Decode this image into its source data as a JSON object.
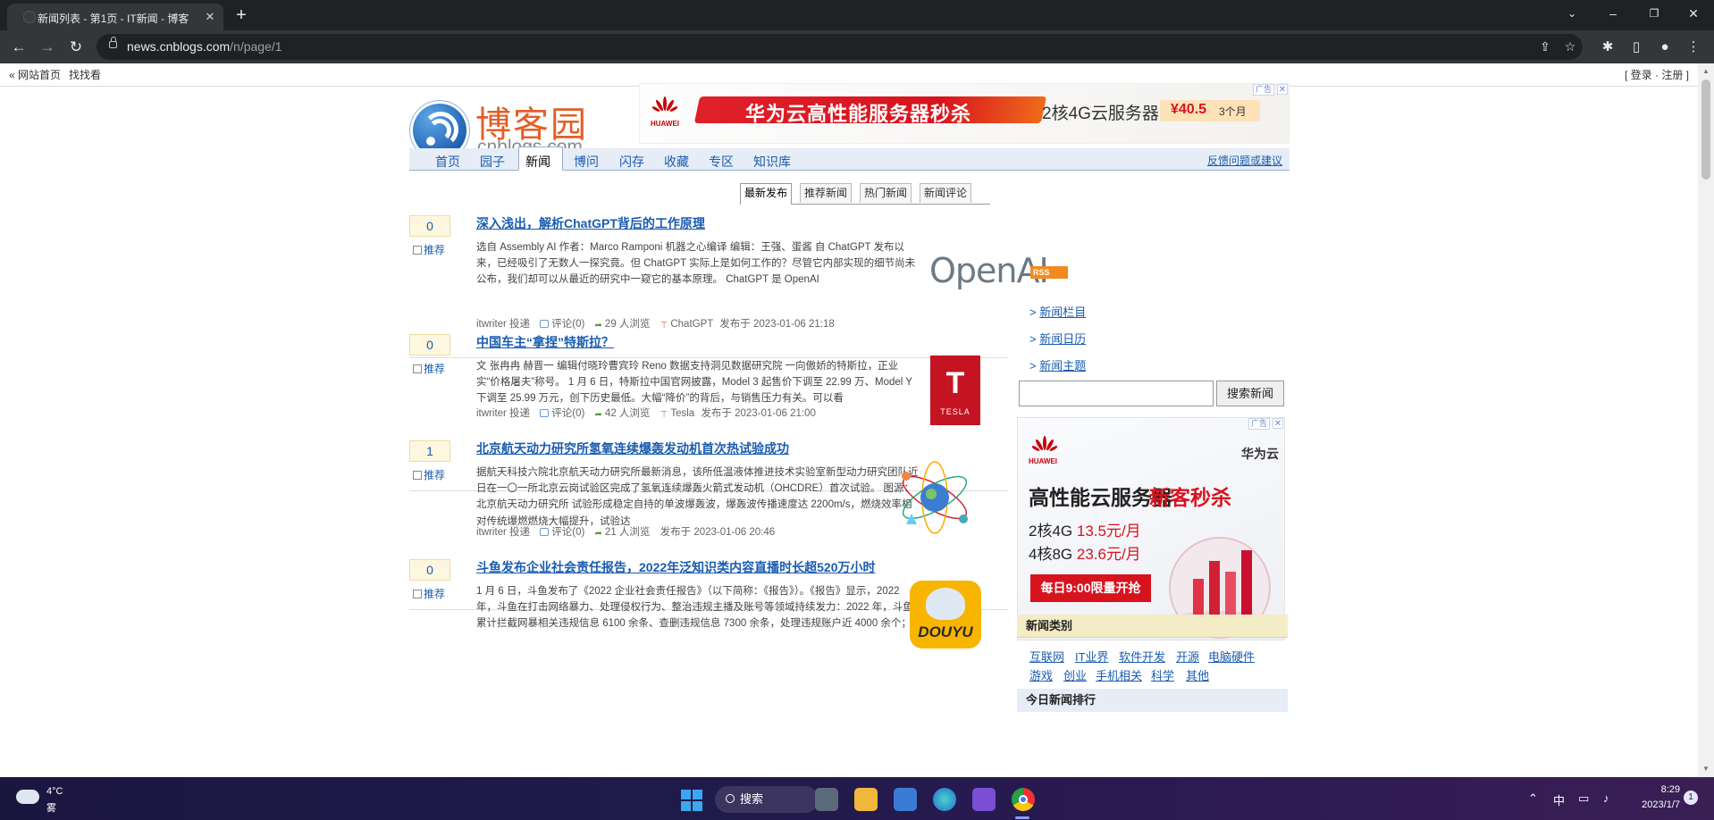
{
  "browser": {
    "tab_title": "新闻列表 - 第1页 - IT新闻 - 博客",
    "url_host": "news.cnblogs.com",
    "url_path": "/n/page/1"
  },
  "topline": {
    "home": "« 网站首页",
    "find": "找找看",
    "auth": "[ 登录 · 注册 ]"
  },
  "header": {
    "logo_cn": "博客园",
    "logo_en": "cnblogs.com"
  },
  "top_ad": {
    "brand": "HUAWEI",
    "title": "华为云高性能服务器秒杀",
    "spec": "2核4G云服务器",
    "price": "¥40.5",
    "period": "3个月",
    "tag": "广告"
  },
  "nav": {
    "items": [
      "首页",
      "园子",
      "新闻",
      "博问",
      "闪存",
      "收藏",
      "专区",
      "知识库"
    ],
    "feedback": "反馈问题或建议"
  },
  "subtabs": [
    "最新发布",
    "推荐新闻",
    "热门新闻",
    "新闻评论"
  ],
  "news": [
    {
      "votes": "0",
      "recommend": "推荐",
      "title": "深入浅出，解析ChatGPT背后的工作原理",
      "summary": "选自 Assembly AI 作者：Marco Ramponi 机器之心编译 编辑：王强、蛋酱 自 ChatGPT 发布以来，已经吸引了无数人一探究竟。但 ChatGPT 实际上是如何工作的？尽管它内部实现的细节尚未公布，我们却可以从最近的研究中一窥它的基本原理。 ChatGPT 是 OpenAI",
      "author": "itwriter 投递",
      "comments": "评论(0)",
      "views": "29 人浏览",
      "tag": "ChatGPT",
      "published": "发布于 2023-01-06 21:18",
      "image": "OpenAI"
    },
    {
      "votes": "0",
      "recommend": "推荐",
      "title": "中国车主“拿捏”特斯拉？",
      "summary": "文 张冉冉 赫晋一 编辑付晓玲曹宾玲 Reno 数据支持洞见数据研究院 一向傲娇的特斯拉，正业实“价格屠夫”称号。 1 月 6 日，特斯拉中国官网披露，Model 3 起售价下调至 22.99 万、Model Y 下调至 25.99 万元，创下历史最低。大幅“降价”的背后，与销售压力有关。可以看",
      "author": "itwriter 投递",
      "comments": "评论(0)",
      "views": "42 人浏览",
      "tag": "Tesla",
      "published": "发布于 2023-01-06 21:00",
      "image": "TESLA"
    },
    {
      "votes": "1",
      "recommend": "推荐",
      "title": "北京航天动力研究所氢氧连续爆轰发动机首次热试验成功",
      "summary": "据航天科技六院北京航天动力研究所最新消息，该所低温液体推进技术实验室新型动力研究团队近日在一〇一所北京云岗试验区完成了氢氧连续爆轰火箭式发动机（OHCDRE）首次试验。 图源：北京航天动力研究所 试验形成稳定自持的单波爆轰波，爆轰波传播速度达 2200m/s，燃烧效率相对传统爆燃燃烧大幅提升，试验达",
      "author": "itwriter 投递",
      "comments": "评论(0)",
      "views": "21 人浏览",
      "tag": "",
      "published": "发布于 2023-01-06 20:46",
      "image": "science"
    },
    {
      "votes": "0",
      "recommend": "推荐",
      "title": "斗鱼发布企业社会责任报告，2022年泛知识类内容直播时长超520万小时",
      "summary": "1 月 6 日，斗鱼发布了《2022 企业社会责任报告》（以下简称：《报告》）。《报告》显示，2022 年，斗鱼在打击网络暴力、处理侵权行为、整治违规主播及账号等领域持续发力：2022 年，斗鱼累计拦截网暴相关违规信息 6100 余条、查删违规信息 7300 余条，处理违规账户近 4000 余个；",
      "author": "itwriter 投递",
      "comments": "评论(0)",
      "views": "",
      "tag": "",
      "published": "",
      "image": "DOUYU"
    }
  ],
  "sidebar": {
    "rss": "RSS",
    "links": [
      "新闻栏目",
      "新闻日历",
      "新闻主题"
    ],
    "search_button": "搜索新闻",
    "search_value": "",
    "ad": {
      "tag": "广告",
      "hw": "HUAWEI",
      "brand": "华为云",
      "title_a": "高性能云服务器",
      "title_b": "新客秒杀",
      "line1_spec": "2核4G",
      "line1_price": "13.5元/月",
      "line2_spec": "4核8G",
      "line2_price": "23.6元/月",
      "cta": "每日9:00限量开抢"
    },
    "categories_title": "新闻类别",
    "categories": [
      "互联网",
      "IT业界",
      "软件开发",
      "开源",
      "电脑硬件",
      "游戏",
      "创业",
      "手机相关",
      "科学",
      "其他"
    ],
    "ranking_title": "今日新闻排行"
  },
  "taskbar": {
    "temp": "4°C",
    "weather": "雾",
    "search": "搜索",
    "ime": "中",
    "time": "8:29",
    "date": "2023/1/7",
    "notifications": "1"
  }
}
